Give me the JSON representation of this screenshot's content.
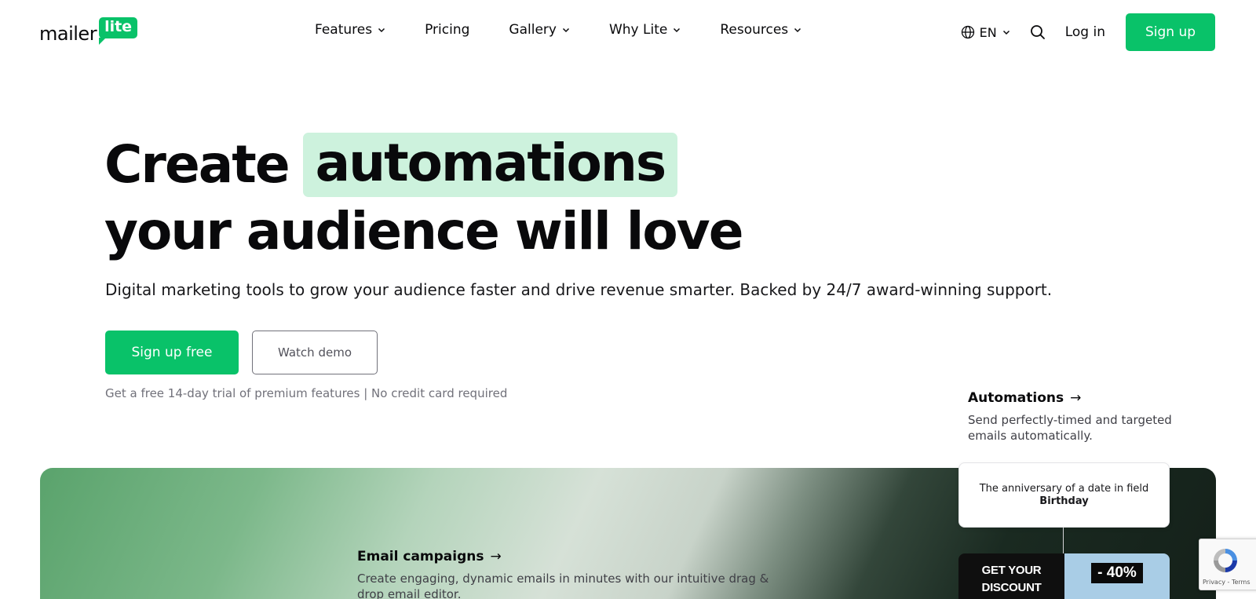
{
  "header": {
    "logo": {
      "word": "mailer",
      "bubble": "lite"
    },
    "nav": [
      {
        "label": "Features",
        "has_dropdown": true
      },
      {
        "label": "Pricing",
        "has_dropdown": false
      },
      {
        "label": "Gallery",
        "has_dropdown": true
      },
      {
        "label": "Why Lite",
        "has_dropdown": true
      },
      {
        "label": "Resources",
        "has_dropdown": true
      }
    ],
    "language": "EN",
    "login_label": "Log in",
    "signup_label": "Sign up"
  },
  "hero": {
    "title_word": "Create",
    "title_highlight": "automations",
    "title_line2": "your audience will love",
    "subtitle": "Digital marketing tools to grow your audience faster and drive revenue smarter. Backed by 24/7 award-winning support.",
    "primary_cta": "Sign up free",
    "secondary_cta": "Watch demo",
    "trial_note": "Get a free 14-day trial of premium features | No credit card required"
  },
  "features": {
    "automations": {
      "title": "Automations",
      "arrow": "→",
      "description": "Send perfectly-timed and targeted emails automatically."
    },
    "email_campaigns": {
      "title": "Email campaigns",
      "arrow": "→",
      "description": "Create engaging, dynamic emails in minutes with our intuitive drag & drop email editor."
    }
  },
  "automation_card": {
    "text": "The anniversary of a date in field",
    "field": "Birthday"
  },
  "email_preview": {
    "headline_1": "GET YOUR",
    "headline_2": "DISCOUNT",
    "badge": "- 40%"
  },
  "recaptcha": {
    "text": "Privacy - Terms"
  },
  "colors": {
    "brand_green": "#09c269",
    "highlight_bg": "#cdf2dd",
    "text": "#09090b",
    "muted": "#71717a"
  }
}
